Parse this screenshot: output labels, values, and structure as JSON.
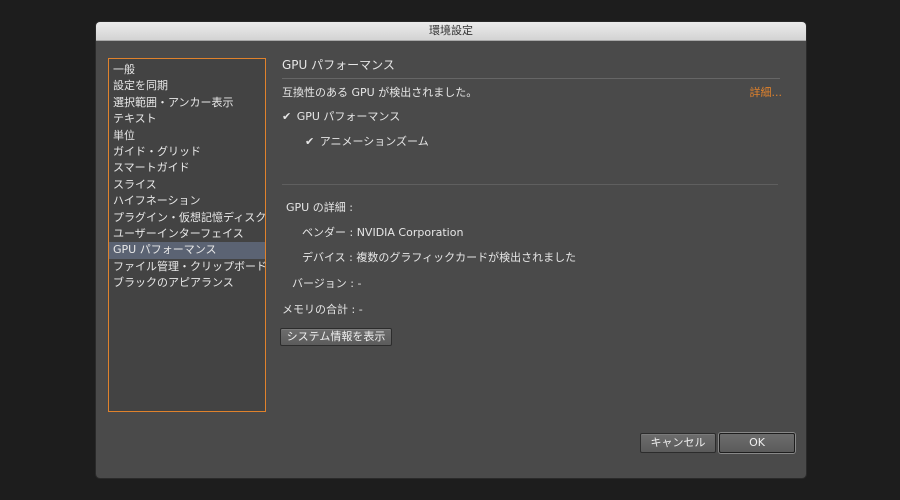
{
  "window": {
    "title": "環境設定"
  },
  "sidebar": {
    "items": [
      {
        "label": "一般"
      },
      {
        "label": "設定を同期"
      },
      {
        "label": "選択範囲・アンカー表示"
      },
      {
        "label": "テキスト"
      },
      {
        "label": "単位"
      },
      {
        "label": "ガイド・グリッド"
      },
      {
        "label": "スマートガイド"
      },
      {
        "label": "スライス"
      },
      {
        "label": "ハイフネーション"
      },
      {
        "label": "プラグイン・仮想記憶ディスク"
      },
      {
        "label": "ユーザーインターフェイス"
      },
      {
        "label": "GPU パフォーマンス"
      },
      {
        "label": "ファイル管理・クリップボード"
      },
      {
        "label": "ブラックのアピアランス"
      }
    ],
    "selected": "GPU パフォーマンス"
  },
  "main": {
    "section_title": "GPU パフォーマンス",
    "detected_text": "互換性のある GPU が検出されました。",
    "details_link": "詳細...",
    "checkbox_gpu": {
      "label": "GPU パフォーマンス",
      "checked": true
    },
    "checkbox_anim": {
      "label": "アニメーションズーム",
      "checked": true
    },
    "gpu_details_heading": "GPU の詳細 :",
    "vendor": "ベンダー : NVIDIA Corporation",
    "device": "デバイス : 複数のグラフィックカードが検出されました",
    "version": "バージョン : -",
    "memory": "メモリの合計 : -",
    "system_info_button": "システム情報を表示"
  },
  "footer": {
    "cancel_label": "キャンセル",
    "ok_label": "OK"
  },
  "colors": {
    "accent": "#e0822c",
    "selection": "#5b6373",
    "panel": "#4a4a4a"
  }
}
